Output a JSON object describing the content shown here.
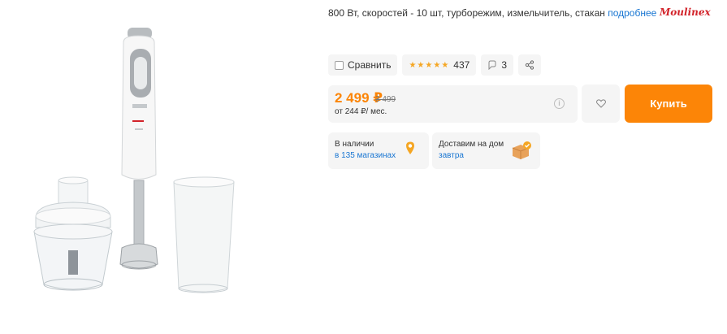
{
  "product": {
    "specs": "800 Вт, скоростей - 10 шт, турборежим, измельчитель, стакан",
    "more_link": "подробнее",
    "brand": "Moulinex"
  },
  "actions": {
    "compare_label": "Сравнить",
    "rating_count": "437",
    "comments_count": "3"
  },
  "price": {
    "current": "2 499 ₽",
    "old": "3 499",
    "credit": "от 244 ₽/ мес."
  },
  "buy_label": "Купить",
  "availability": {
    "stores_title": "В наличии",
    "stores_link": "в 135 магазинах",
    "delivery_title": "Доставим на дом",
    "delivery_link": "завтра"
  },
  "colors": {
    "accent": "#fc8507",
    "link": "#1976d2",
    "card_bg": "#f5f5f5",
    "brand_red": "#d2232a"
  },
  "icons": [
    "checkbox-icon",
    "star-icon",
    "comment-icon",
    "share-icon",
    "info-icon",
    "heart-icon",
    "map-pin-icon",
    "delivery-box-icon"
  ]
}
